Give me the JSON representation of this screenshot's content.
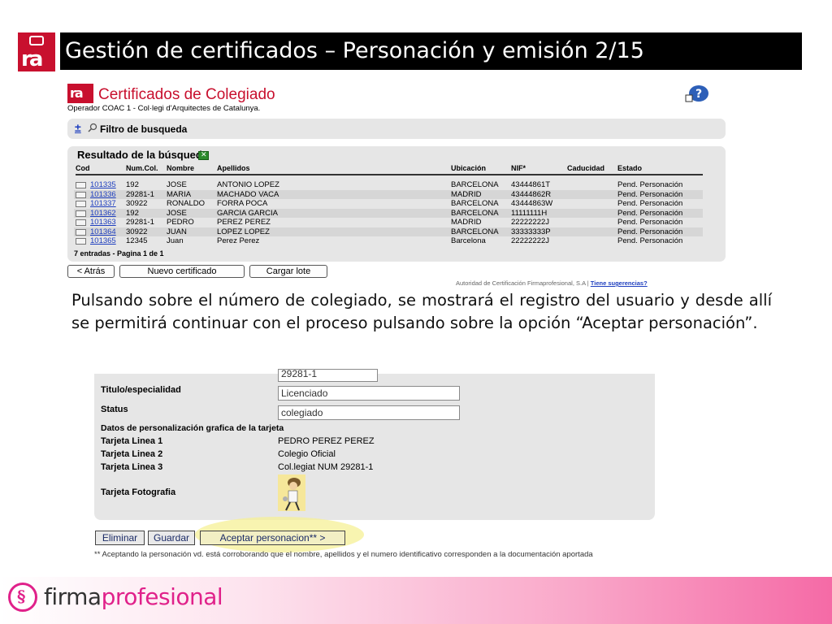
{
  "slide": {
    "title": "Gestión de certificados – Personación y emisión 2/15",
    "paragraph": "Pulsando sobre el número de colegiado, se mostrará el registro del usuario y desde allí se permitirá continuar con el proceso pulsando sobre la opción “Aceptar personación”.",
    "logo_text": "ra"
  },
  "certificados": {
    "title": "Certificados de Colegiado",
    "operator_line": "Operador COAC 1 - Col·legi d'Arquitectes de Catalunya.",
    "filter_toggle": "±",
    "filter_label": "Filtro de busqueda",
    "results_title": "Resultado de la búsqueda",
    "columns": [
      "Cod",
      "Num.Col.",
      "Nombre",
      "Apellidos",
      "Ubicación",
      "NIF*",
      "Caducidad",
      "Estado"
    ],
    "rows": [
      [
        "101335",
        "192",
        "JOSE",
        "ANTONIO LOPEZ",
        "BARCELONA",
        "43444861T",
        "",
        "Pend. Personación"
      ],
      [
        "101336",
        "29281-1",
        "MARIA",
        "MACHADO VACA",
        "MADRID",
        "43444862R",
        "",
        "Pend. Personación"
      ],
      [
        "101337",
        "30922",
        "RONALDO",
        "FORRA POCA",
        "BARCELONA",
        "43444863W",
        "",
        "Pend. Personación"
      ],
      [
        "101362",
        "192",
        "JOSE",
        "GARCIA GARCIA",
        "BARCELONA",
        "11111111H",
        "",
        "Pend. Personación"
      ],
      [
        "101363",
        "29281-1",
        "PEDRO",
        "PEREZ PEREZ",
        "MADRID",
        "22222222J",
        "",
        "Pend. Personación"
      ],
      [
        "101364",
        "30922",
        "JUAN",
        "LOPEZ LOPEZ",
        "BARCELONA",
        "33333333P",
        "",
        "Pend. Personación"
      ],
      [
        "101365",
        "12345",
        "Juan",
        "Perez Perez",
        "Barcelona",
        "22222222J",
        "",
        "Pend. Personación"
      ]
    ],
    "footer": "7 entradas - Pagina 1 de 1",
    "buttons": {
      "back": "< Atrás",
      "new": "Nuevo certificado",
      "load": "Cargar lote"
    },
    "authority": "Autoridad de Certificación Firmaprofesional, S.A |",
    "suggestions": "Tiene sugerencias?"
  },
  "registro": {
    "partial_value": "29281-1",
    "titulo_label": "Titulo/especialidad",
    "titulo_value": "Licenciado",
    "status_label": "Status",
    "status_value": "colegiado",
    "section_label": "Datos de personalización grafica de la tarjeta",
    "lines": [
      {
        "label": "Tarjeta Linea 1",
        "value": "PEDRO PEREZ PEREZ"
      },
      {
        "label": "Tarjeta Linea 2",
        "value": "Colegio Oficial"
      },
      {
        "label": "Tarjeta Linea 3",
        "value": "Col.legiat NUM 29281-1"
      }
    ],
    "photo_label": "Tarjeta Fotografia",
    "buttons": {
      "delete": "Eliminar",
      "save": "Guardar",
      "accept": "Aceptar personacion** >"
    },
    "note": "** Aceptando la personación vd. está corroborando que el nombre, apellidos y el numero identificativo corresponden a la documentación aportada"
  },
  "footer": {
    "brand_a": "firma",
    "brand_b": "profesional"
  },
  "colors": {
    "brand_red": "#c8102e",
    "brand_pink": "#e0218a",
    "link_blue": "#1f3fbf"
  }
}
